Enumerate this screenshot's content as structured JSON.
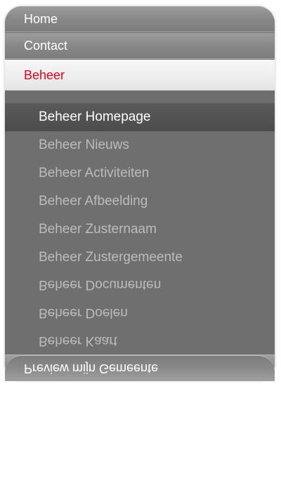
{
  "menu": {
    "top_items": [
      {
        "label": "Home"
      },
      {
        "label": "Contact"
      },
      {
        "label": "Beheer"
      }
    ],
    "sub_items": [
      {
        "label": "Beheer Homepage"
      },
      {
        "label": "Beheer Nieuws"
      },
      {
        "label": "Beheer Activiteiten"
      },
      {
        "label": "Beheer Afbeelding"
      },
      {
        "label": "Beheer Zusternaam"
      },
      {
        "label": "Beheer Zustergemeente"
      },
      {
        "label": "Beheer Documenten"
      },
      {
        "label": "Beheer Doelen"
      },
      {
        "label": "Beheer Kaart"
      }
    ],
    "bottom_item": {
      "label": "Preview mijn Gemeente"
    }
  },
  "colors": {
    "active_text": "#e0001b",
    "panel_bg": "#6e6e6e",
    "sub_text": "#bcbcbc"
  }
}
